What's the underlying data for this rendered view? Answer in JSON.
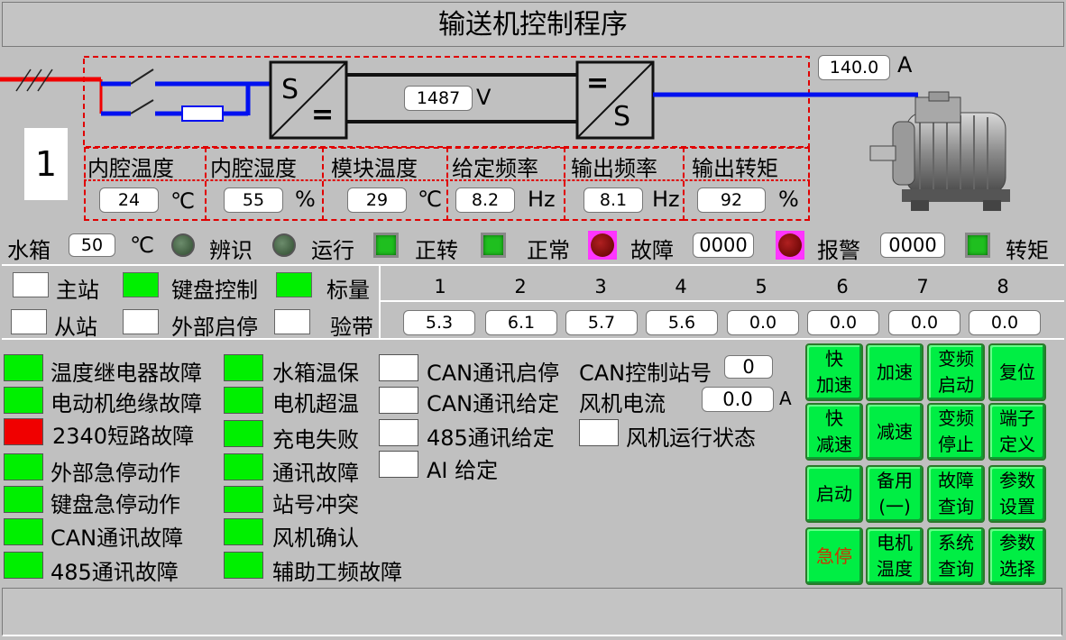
{
  "title": "输送机控制程序",
  "station_number": "1",
  "diagram": {
    "dc_voltage": "1487",
    "dc_unit": "V",
    "motor_current": "140.0",
    "current_unit": "A",
    "rect_label_top": "S",
    "rect_label_bottom": "=",
    "inv_label_top": "=",
    "inv_label_bottom": "S"
  },
  "measurements": [
    {
      "label": "内腔温度",
      "value": "24",
      "unit": "℃"
    },
    {
      "label": "内腔湿度",
      "value": "55",
      "unit": "%"
    },
    {
      "label": "模块温度",
      "value": "29",
      "unit": "℃"
    },
    {
      "label": "给定频率",
      "value": "8.2",
      "unit": "Hz"
    },
    {
      "label": "输出频率",
      "value": "8.1",
      "unit": "Hz"
    },
    {
      "label": "输出转矩",
      "value": "92",
      "unit": "%"
    }
  ],
  "status_row": {
    "tank_label": "水箱",
    "tank_value": "50",
    "tank_unit": "℃",
    "identify": "辨识",
    "run": "运行",
    "forward": "正转",
    "normal": "正常",
    "fault": "故障",
    "fault_code": "0000",
    "alarm": "报警",
    "alarm_code": "0000",
    "torque": "转矩"
  },
  "mode": {
    "master": "主站",
    "keyboard": "键盘控制",
    "scalar": "标量",
    "slave": "从站",
    "external": "外部启停",
    "belt_check": "验带"
  },
  "channels": {
    "headers": [
      "1",
      "2",
      "3",
      "4",
      "5",
      "6",
      "7",
      "8"
    ],
    "values": [
      "5.3",
      "6.1",
      "5.7",
      "5.6",
      "0.0",
      "0.0",
      "0.0",
      "0.0"
    ]
  },
  "faults_col1": [
    {
      "label": "温度继电器故障",
      "state": "green"
    },
    {
      "label": "电动机绝缘故障",
      "state": "green"
    },
    {
      "label": "2340短路故障",
      "state": "red"
    },
    {
      "label": "外部急停动作",
      "state": "green"
    },
    {
      "label": "键盘急停动作",
      "state": "green"
    },
    {
      "label": "CAN通讯故障",
      "state": "green"
    },
    {
      "label": "485通讯故障",
      "state": "green"
    }
  ],
  "faults_col2": [
    {
      "label": "水箱温保",
      "state": "green"
    },
    {
      "label": "电机超温",
      "state": "green"
    },
    {
      "label": "充电失败",
      "state": "green"
    },
    {
      "label": "通讯故障",
      "state": "green"
    },
    {
      "label": "站号冲突",
      "state": "green"
    },
    {
      "label": "风机确认",
      "state": "green"
    },
    {
      "label": "辅助工频故障",
      "state": "green"
    }
  ],
  "comm": {
    "can_start": "CAN通讯启停",
    "can_set": "CAN通讯给定",
    "rs485_set": "485通讯给定",
    "ai_set": "AI 给定",
    "can_station_label": "CAN控制站号",
    "can_station_value": "0",
    "fan_current_label": "风机电流",
    "fan_current_value": "0.0",
    "fan_current_unit": "A",
    "fan_status_label": "风机运行状态"
  },
  "buttons": [
    "快\n加速",
    "加速",
    "变频\n启动",
    "复位",
    "快\n减速",
    "减速",
    "变频\n停止",
    "端子\n定义",
    "启动",
    "备用\n(一)",
    "故障\n查询",
    "参数\n设置",
    "急停",
    "电机\n温度",
    "系统\n查询",
    "参数\n选择"
  ],
  "colors": {
    "indicator_green": "#00f000",
    "indicator_red": "#f00000",
    "button_green": "#00ee44",
    "stop_text": "#d03000",
    "dash_border": "#e00000"
  }
}
